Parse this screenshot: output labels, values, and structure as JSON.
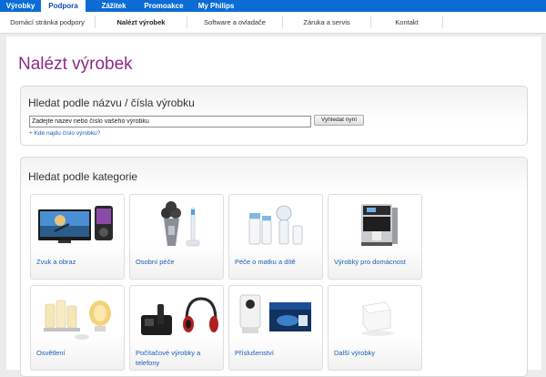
{
  "topnav": {
    "tabs": [
      {
        "label": "Výrobky",
        "active": false
      },
      {
        "label": "Podpora",
        "active": true
      },
      {
        "label": "Zážitek",
        "active": false
      },
      {
        "label": "Promoakce",
        "active": false
      },
      {
        "label": "My Philips",
        "active": false
      }
    ]
  },
  "subnav": {
    "items": [
      {
        "label": "Domácí stránka podpory",
        "active": false
      },
      {
        "label": "Nalézt výrobek",
        "active": true
      },
      {
        "label": "Software a ovladače",
        "active": false
      },
      {
        "label": "Záruka a servis",
        "active": false
      },
      {
        "label": "Kontakt",
        "active": false
      }
    ]
  },
  "page": {
    "title": "Nalézt výrobek"
  },
  "search": {
    "title": "Hledat podle názvu / čísla výrobku",
    "value": "Zadejte název nebo číslo vašeho výrobku",
    "button_label": "Vyhledat nyní",
    "help_link": "+ Kde najdu číslo výrobku?"
  },
  "categories": {
    "title": "Hledat podle kategorie",
    "items": [
      {
        "label": "Zvuk a obraz",
        "icon": "tv-mp3-player"
      },
      {
        "label": "Osobní péče",
        "icon": "shaver-toothbrush"
      },
      {
        "label": "Péče o matku a dítě",
        "icon": "baby-bottles-breast-pump"
      },
      {
        "label": "Výrobky pro domácnost",
        "icon": "espresso-machine"
      },
      {
        "label": "Osvětlení",
        "icon": "lamps"
      },
      {
        "label": "Počítačové výrobky a telefony",
        "icon": "phone-headphones"
      },
      {
        "label": "Příslušenství",
        "icon": "webcam-box"
      },
      {
        "label": "Další výrobky",
        "icon": "white-cube"
      }
    ]
  },
  "colors": {
    "nav_blue": "#0a6cd4",
    "title_purple": "#8a2b8a",
    "link_blue": "#1a5fb4"
  }
}
